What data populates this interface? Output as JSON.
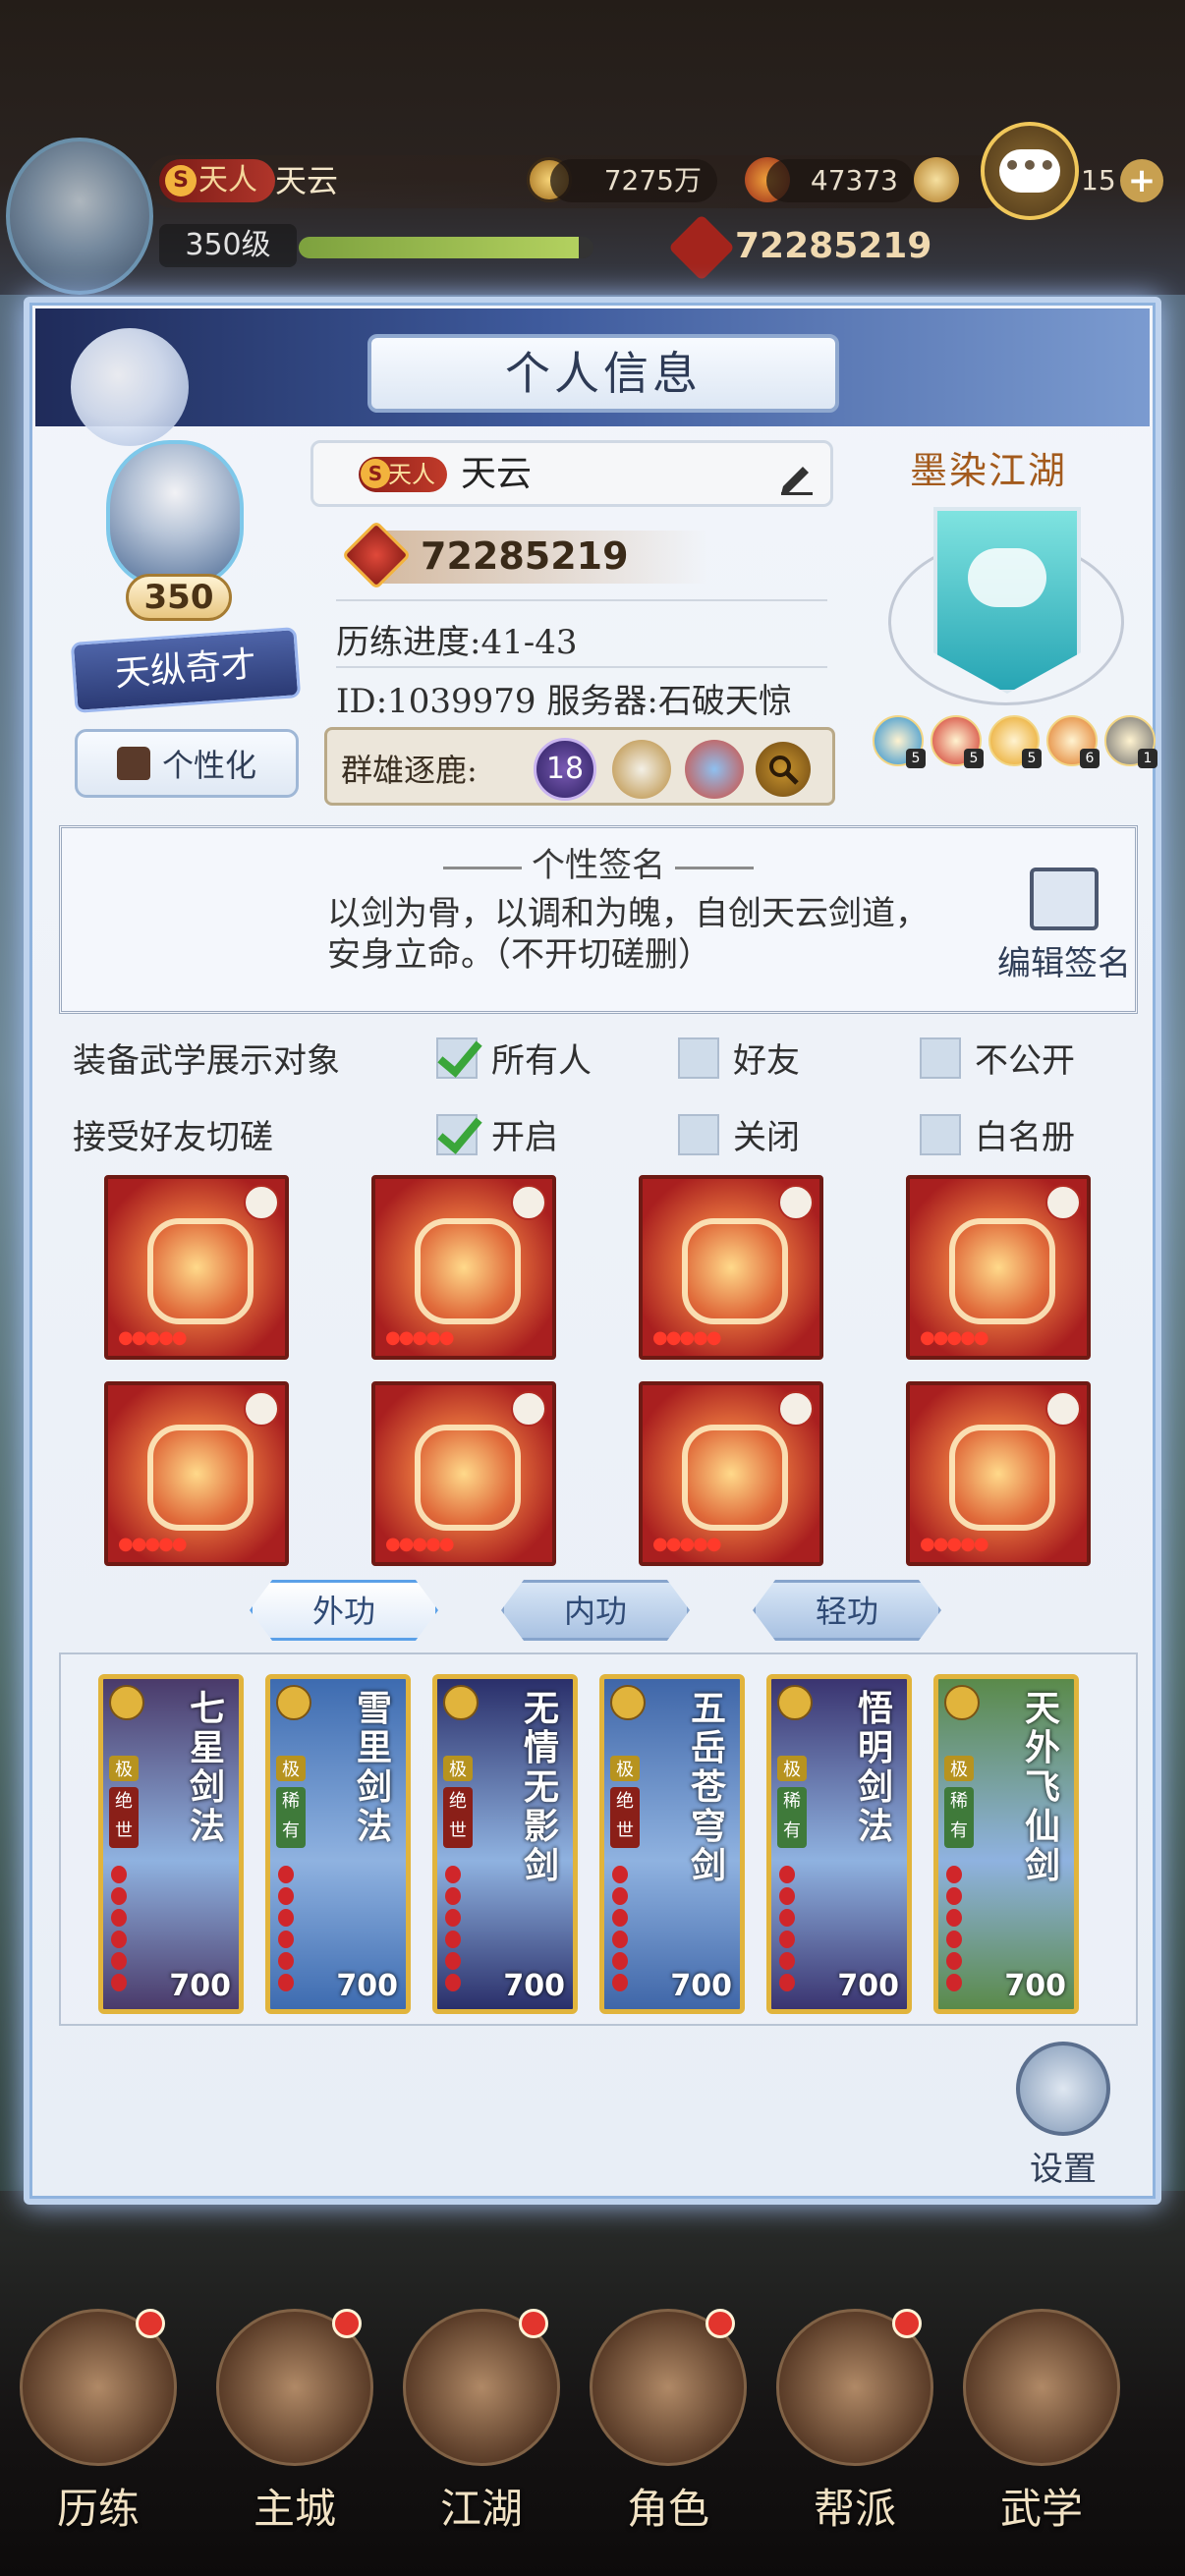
{
  "hud": {
    "rank_badge": "S",
    "rank": "天人",
    "name": "天云",
    "coins": "7275万",
    "gems": "47373",
    "tickets": "15",
    "level": "350级",
    "xp_progress": 0.95,
    "power": "72285219"
  },
  "panel": {
    "title": "个人信息",
    "profile": {
      "level": "350",
      "title_banner": "天纵奇才",
      "personalize_label": "个性化",
      "rank_badge": "S",
      "rank": "天人",
      "name": "天云",
      "power": "72285219",
      "progress": "历练进度:41-43",
      "id_server": "ID:1039979  服务器:石破天惊",
      "arena_label": "群雄逐鹿:",
      "arena_rank": "18"
    },
    "guild": {
      "name": "墨染江湖",
      "buffs": [
        {
          "level": "5",
          "color": "#2a8fd0"
        },
        {
          "level": "5",
          "color": "#d0342a"
        },
        {
          "level": "5",
          "color": "#e8a31f"
        },
        {
          "level": "6",
          "color": "#e07a26"
        },
        {
          "level": "1",
          "color": "#6d6d6d"
        }
      ]
    },
    "signature": {
      "title": "个性签名",
      "text": "以剑为骨，以调和为魄，自创天云剑道，安身立命。（不开切磋删）",
      "edit_label": "编辑签名"
    },
    "options": {
      "display_label": "装备武学展示对象",
      "display_all": "所有人",
      "display_friends": "好友",
      "display_private": "不公开",
      "duel_label": "接受好友切磋",
      "duel_on": "开启",
      "duel_off": "关闭",
      "duel_whitelist": "白名册"
    },
    "tabs": [
      "外功",
      "内功",
      "轻功"
    ],
    "skills": [
      {
        "name": "七星剑法",
        "grade": "绝世",
        "level": "700"
      },
      {
        "name": "雪里剑法",
        "grade": "稀有",
        "level": "700"
      },
      {
        "name": "无情无影剑",
        "grade": "绝世",
        "level": "700"
      },
      {
        "name": "五岳苍穹剑",
        "grade": "绝世",
        "level": "700"
      },
      {
        "name": "悟明剑法",
        "grade": "稀有",
        "level": "700"
      },
      {
        "name": "天外飞仙剑",
        "grade": "稀有",
        "level": "700"
      }
    ],
    "skill_tag": "极",
    "settings_label": "设置"
  },
  "nav": [
    "历练",
    "主城",
    "江湖",
    "角色",
    "帮派",
    "武学"
  ],
  "colors": {
    "accent": "#5aa0e8",
    "panel_bg": "#eef2f8",
    "gold": "#e1b43c",
    "equip_red": "#a91f1f"
  }
}
